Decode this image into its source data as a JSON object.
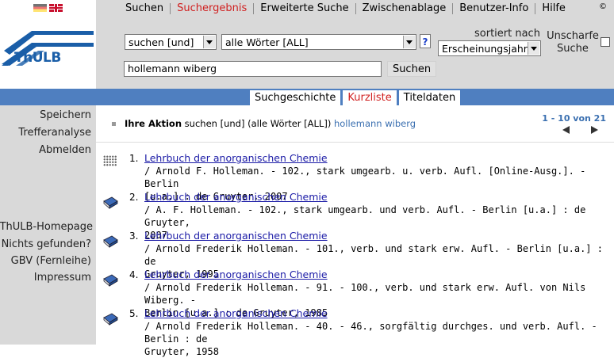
{
  "nav": {
    "tabs": [
      "Suchen",
      "Suchergebnis",
      "Erweiterte Suche",
      "Zwischenablage",
      "Benutzer-Info",
      "Hilfe"
    ],
    "active": "Suchergebnis",
    "copyright": "©"
  },
  "logo": {
    "text": "ThULB"
  },
  "search": {
    "mode_select": "suchen [und]",
    "field_select": "alle Wörter [ALL]",
    "help": "?",
    "sort_label": "sortiert nach",
    "sort_select": "Erscheinungsjahr",
    "fuzzy_label": "Unscharfe Suche",
    "query": "hollemann wiberg",
    "button": "Suchen"
  },
  "subtabs": {
    "items": [
      "Suchgeschichte",
      "Kurzliste",
      "Titeldaten"
    ],
    "active": "Kurzliste"
  },
  "sidebar": {
    "top": [
      "Speichern",
      "Trefferanalyse",
      "Abmelden"
    ],
    "bottom": [
      "ThULB-Homepage",
      "Nichts gefunden?",
      "GBV (Fernleihe)",
      "Impressum"
    ]
  },
  "action": {
    "label": "Ihre Aktion",
    "text": " suchen [und] (alle Wörter [ALL]) ",
    "query": "hollemann wiberg",
    "pager": "1 - 10 von 21"
  },
  "results": [
    {
      "num": "1.",
      "icon": "online-resource-icon",
      "title": "Lehrbuch der anorganischen Chemie",
      "desc": "/ Arnold F. Holleman. - 102., stark umgearb. u. verb. Aufl. [Online-Ausg.]. - Berlin\n[u.a.] : de Gruyter, 2007"
    },
    {
      "num": "2.",
      "icon": "book-icon",
      "title": "Lehrbuch der anorganischen Chemie",
      "desc": "/ A. F. Holleman. - 102., stark umgearb. und verb. Aufl. - Berlin [u.a.] : de Gruyter,\n2007"
    },
    {
      "num": "3.",
      "icon": "book-icon",
      "title": "Lehrbuch der anorganischen Chemie",
      "desc": "/ Arnold Frederik Holleman. - 101., verb. und stark erw. Aufl. - Berlin [u.a.] : de\nGruyter, 1995"
    },
    {
      "num": "4.",
      "icon": "book-icon",
      "title": "Lehrbuch der anorganischen Chemie",
      "desc": "/ Arnold Frederik Holleman. - 91. - 100., verb. und stark erw. Aufl. von Nils Wiberg. -\nBerlin [u.a.] : de Gruyter, 1985"
    },
    {
      "num": "5.",
      "icon": "book-icon",
      "title": "Lehrbuch der anorganischen Chemie",
      "desc": "/ Arnold Frederik Holleman. - 40. - 46., sorgfältig durchges. und verb. Aufl. - Berlin : de\nGruyter, 1958"
    }
  ]
}
